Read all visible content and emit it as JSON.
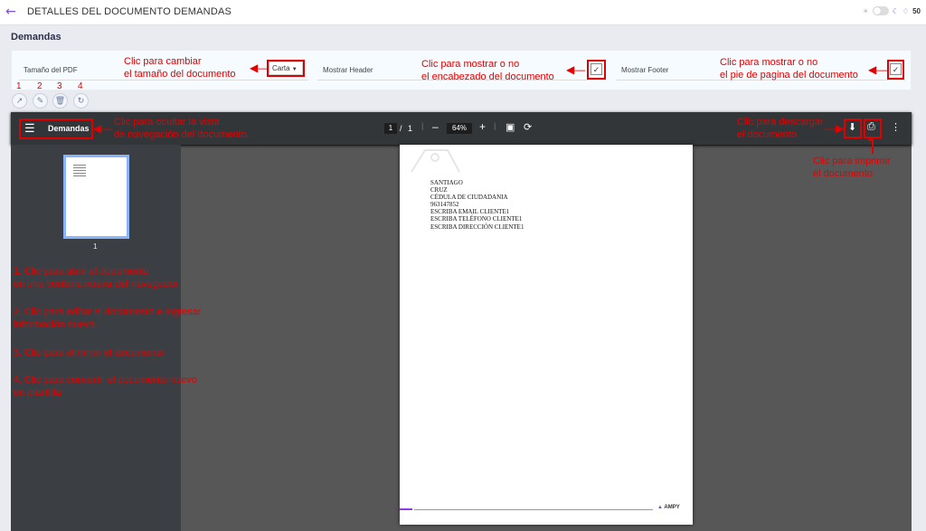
{
  "header": {
    "back_icon": "arrow-left-icon",
    "title": "DETALLES DEL DOCUMENTO DEMANDAS",
    "notif_count": "50"
  },
  "section": {
    "title": "Demandas"
  },
  "config": {
    "pdf_size_label": "Tamaño del PDF",
    "pdf_size_value": "Carta",
    "show_header_label": "Mostrar Header",
    "show_footer_label": "Mostrar Footer"
  },
  "annotations": {
    "size_1": "Clic para cambiar",
    "size_2": "el tamaño del documento",
    "header_1": "Clic para mostrar o no",
    "header_2": "el encabezado del documento",
    "footer_1": "Clic para mostrar o no",
    "footer_2": "el pie de pagina del documento",
    "nav_1": "Clic para ocultar la vista",
    "nav_2": "de navegación del documento.",
    "dl_1": "Clic para descargar",
    "dl_2": "el documento",
    "print_1": "Clic para imprimir",
    "print_2": "el documento",
    "l1a": "1. Clic para abrir el documento",
    "l1b": "en una ventana nueva del navegador",
    "l2a": "2. Clic para editar el documento e ingresar",
    "l2b": "información nueva.",
    "l3": "3. Clic para eliminar el documento",
    "l4a": "4. Clic para convertir el documento nuevo",
    "l4b": "en plantilla"
  },
  "action_numbers": [
    "1",
    "2",
    "3",
    "4"
  ],
  "viewer": {
    "doc_name": "Demandas",
    "page_current": "1",
    "page_sep": "/",
    "page_total": "1",
    "zoom": "64%",
    "thumb_page": "1"
  },
  "document": {
    "lines": [
      "SANTIAGO",
      "CRUZ",
      "CÉDULA DE CIUDADANIA",
      "963147852",
      "ESCRIBA EMAIL CLIENTE1",
      "ESCRIBA TELÉFONO CLIENTE1",
      "ESCRIBA DIRECCIÓN CLIENTE1"
    ],
    "footer_brand": "AMPY"
  },
  "colors": {
    "accent": "#7b4fd6",
    "annotation": "#e40000"
  }
}
